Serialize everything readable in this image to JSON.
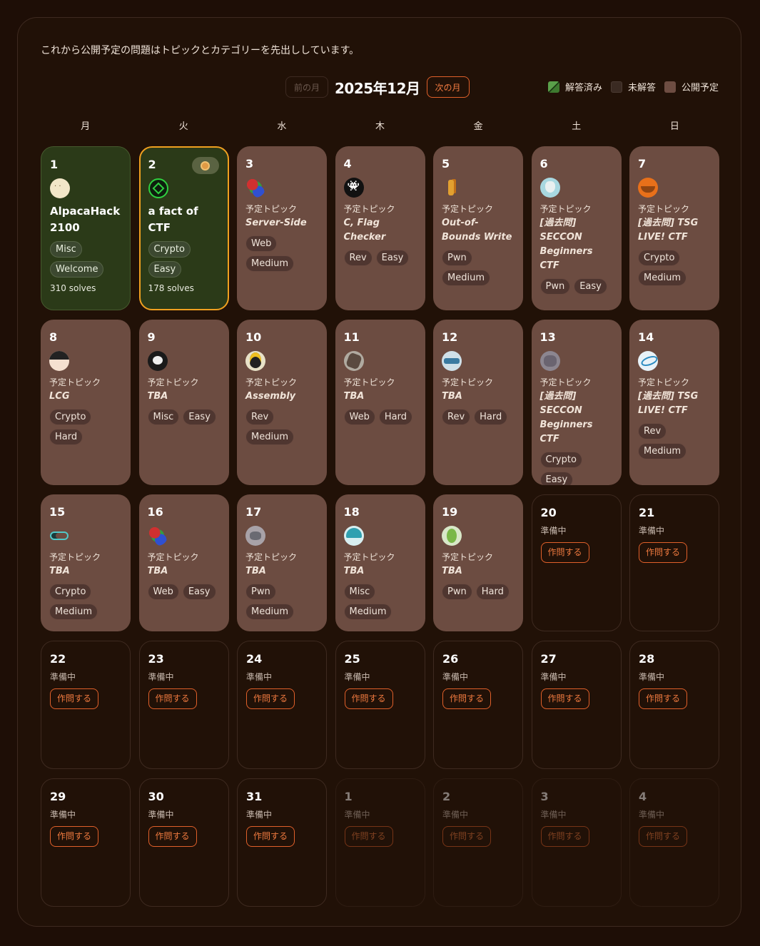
{
  "intro": "これから公開予定の問題はトピックとカテゴリーを先出ししています。",
  "nav": {
    "prev_label": "前の月",
    "month_title": "2025年12月",
    "next_label": "次の月"
  },
  "legend": {
    "solved": "解答済み",
    "unsolved": "未解答",
    "upcoming": "公開予定"
  },
  "weekdays": [
    "月",
    "火",
    "水",
    "木",
    "金",
    "土",
    "日"
  ],
  "labels": {
    "upcoming": "予定トピック",
    "preparing": "準備中",
    "author": "作問する"
  },
  "colors": {
    "background": "#1e0e06",
    "upcoming_cell": "#6c4c41",
    "solved_cell": "#2b3a18",
    "highlight": "#f0a020",
    "accent": "#f07a3f"
  },
  "days": [
    {
      "day": "1",
      "status": "solved",
      "avatar": "alpaca-icon",
      "title": "AlpacaHack 2100",
      "tags": [
        "Misc",
        "Welcome"
      ],
      "solves": "310 solves"
    },
    {
      "day": "2",
      "status": "solved",
      "highlight": true,
      "medal": true,
      "avatar": "green-emblem-icon",
      "title": "a fact of CTF",
      "tags": [
        "Crypto",
        "Easy"
      ],
      "solves": "178 solves"
    },
    {
      "day": "3",
      "status": "upcoming",
      "avatar": "parrot-icon",
      "topic": "Server-Side",
      "tags": [
        "Web",
        "Medium"
      ]
    },
    {
      "day": "4",
      "status": "upcoming",
      "avatar": "invader-icon",
      "topic": "C, Flag Checker",
      "tags": [
        "Rev",
        "Easy"
      ]
    },
    {
      "day": "5",
      "status": "upcoming",
      "avatar": "giraffe-icon",
      "topic": "Out-of-Bounds Write",
      "tags": [
        "Pwn",
        "Medium"
      ]
    },
    {
      "day": "6",
      "status": "upcoming",
      "avatar": "wolf-icon",
      "topic": "[過去問] SECCON Beginners CTF",
      "tags": [
        "Pwn",
        "Easy"
      ]
    },
    {
      "day": "7",
      "status": "upcoming",
      "avatar": "orange-face-icon",
      "topic": "[過去問] TSG LIVE! CTF",
      "tags": [
        "Crypto",
        "Medium"
      ]
    },
    {
      "day": "8",
      "status": "upcoming",
      "avatar": "anime-face-icon",
      "topic": "LCG",
      "tags": [
        "Crypto",
        "Hard"
      ]
    },
    {
      "day": "9",
      "status": "upcoming",
      "avatar": "ghost-icon",
      "topic": "TBA",
      "tags": [
        "Misc",
        "Easy"
      ]
    },
    {
      "day": "10",
      "status": "upcoming",
      "avatar": "cat-face-icon",
      "topic": "Assembly",
      "tags": [
        "Rev",
        "Medium"
      ]
    },
    {
      "day": "11",
      "status": "upcoming",
      "avatar": "wolf-dark-icon",
      "topic": "TBA",
      "tags": [
        "Web",
        "Hard"
      ]
    },
    {
      "day": "12",
      "status": "upcoming",
      "avatar": "robot-icon",
      "topic": "TBA",
      "tags": [
        "Rev",
        "Hard"
      ]
    },
    {
      "day": "13",
      "status": "upcoming",
      "avatar": "cat-gray-icon",
      "topic": "[過去問] SECCON Beginners CTF",
      "tags": [
        "Crypto",
        "Easy"
      ]
    },
    {
      "day": "14",
      "status": "upcoming",
      "avatar": "tsg-logo-icon",
      "topic": "[過去問] TSG LIVE! CTF",
      "tags": [
        "Rev",
        "Medium"
      ]
    },
    {
      "day": "15",
      "status": "upcoming",
      "avatar": "mask-icon",
      "topic": "TBA",
      "tags": [
        "Crypto",
        "Medium"
      ]
    },
    {
      "day": "16",
      "status": "upcoming",
      "avatar": "parrot-icon",
      "topic": "TBA",
      "tags": [
        "Web",
        "Easy"
      ]
    },
    {
      "day": "17",
      "status": "upcoming",
      "avatar": "cat-photo-icon",
      "topic": "TBA",
      "tags": [
        "Pwn",
        "Medium"
      ]
    },
    {
      "day": "18",
      "status": "upcoming",
      "avatar": "anime-girl-icon",
      "topic": "TBA",
      "tags": [
        "Misc",
        "Medium"
      ]
    },
    {
      "day": "19",
      "status": "upcoming",
      "avatar": "bird-icon",
      "topic": "TBA",
      "tags": [
        "Pwn",
        "Hard"
      ]
    },
    {
      "day": "20",
      "status": "empty"
    },
    {
      "day": "21",
      "status": "empty"
    },
    {
      "day": "22",
      "status": "empty"
    },
    {
      "day": "23",
      "status": "empty"
    },
    {
      "day": "24",
      "status": "empty"
    },
    {
      "day": "25",
      "status": "empty"
    },
    {
      "day": "26",
      "status": "empty"
    },
    {
      "day": "27",
      "status": "empty"
    },
    {
      "day": "28",
      "status": "empty"
    },
    {
      "day": "29",
      "status": "empty"
    },
    {
      "day": "30",
      "status": "empty"
    },
    {
      "day": "31",
      "status": "empty"
    },
    {
      "day": "1",
      "status": "empty",
      "outside": true
    },
    {
      "day": "2",
      "status": "empty",
      "outside": true
    },
    {
      "day": "3",
      "status": "empty",
      "outside": true
    },
    {
      "day": "4",
      "status": "empty",
      "outside": true
    }
  ]
}
